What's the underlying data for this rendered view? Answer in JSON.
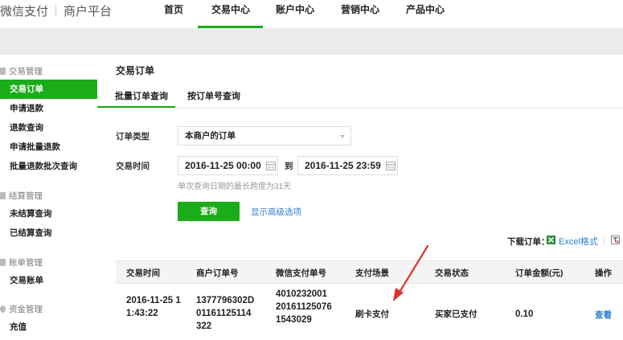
{
  "header": {
    "brand_left": "微信支付",
    "brand_right": "商户平台",
    "nav": [
      "首页",
      "交易中心",
      "账户中心",
      "营销中心",
      "产品中心"
    ],
    "active_nav": "交易中心"
  },
  "sidebar": {
    "groups": [
      {
        "title": "交易管理",
        "items": [
          "交易订单",
          "申请退款",
          "退款查询",
          "申请批量退款",
          "批量退款批次查询"
        ]
      },
      {
        "title": "结算管理",
        "items": [
          "未结算查询",
          "已结算查询"
        ]
      },
      {
        "title": "账单管理",
        "items": [
          "交易账单"
        ]
      },
      {
        "title": "资金管理",
        "items": [
          "充值"
        ]
      }
    ],
    "active_item": "交易订单"
  },
  "main": {
    "title": "交易订单",
    "tabs": [
      "批量订单查询",
      "按订单号查询"
    ],
    "active_tab": "批量订单查询",
    "order_type_label": "订单类型",
    "order_type_value": "本商户的订单",
    "trade_time_label": "交易时间",
    "start_time": "2016-11-25 00:00",
    "to_label": "到",
    "end_time": "2016-11-25 23:59",
    "hint": "单次查询日期的最长跨度为31天",
    "query_button": "查询",
    "advanced_link": "显示高级选项",
    "download_label": "下载订单：",
    "excel_link": "Excel格式"
  },
  "table": {
    "headers": [
      "交易时间",
      "商户订单号",
      "微信支付单号",
      "支付场景",
      "交易状态",
      "订单金额(元)",
      "操作"
    ],
    "rows": [
      {
        "time": "2016-11-25 11:43:22",
        "merchant_order": "1377796302D01161125114322",
        "wechat_order": "4010232001201611250761543029",
        "scene": "刷卡支付",
        "status": "买家已支付",
        "amount": "0.10",
        "action": "查看"
      }
    ]
  },
  "colors": {
    "accent": "#1aad19",
    "link": "#2a7fd4",
    "arrow": "#e0342b"
  }
}
